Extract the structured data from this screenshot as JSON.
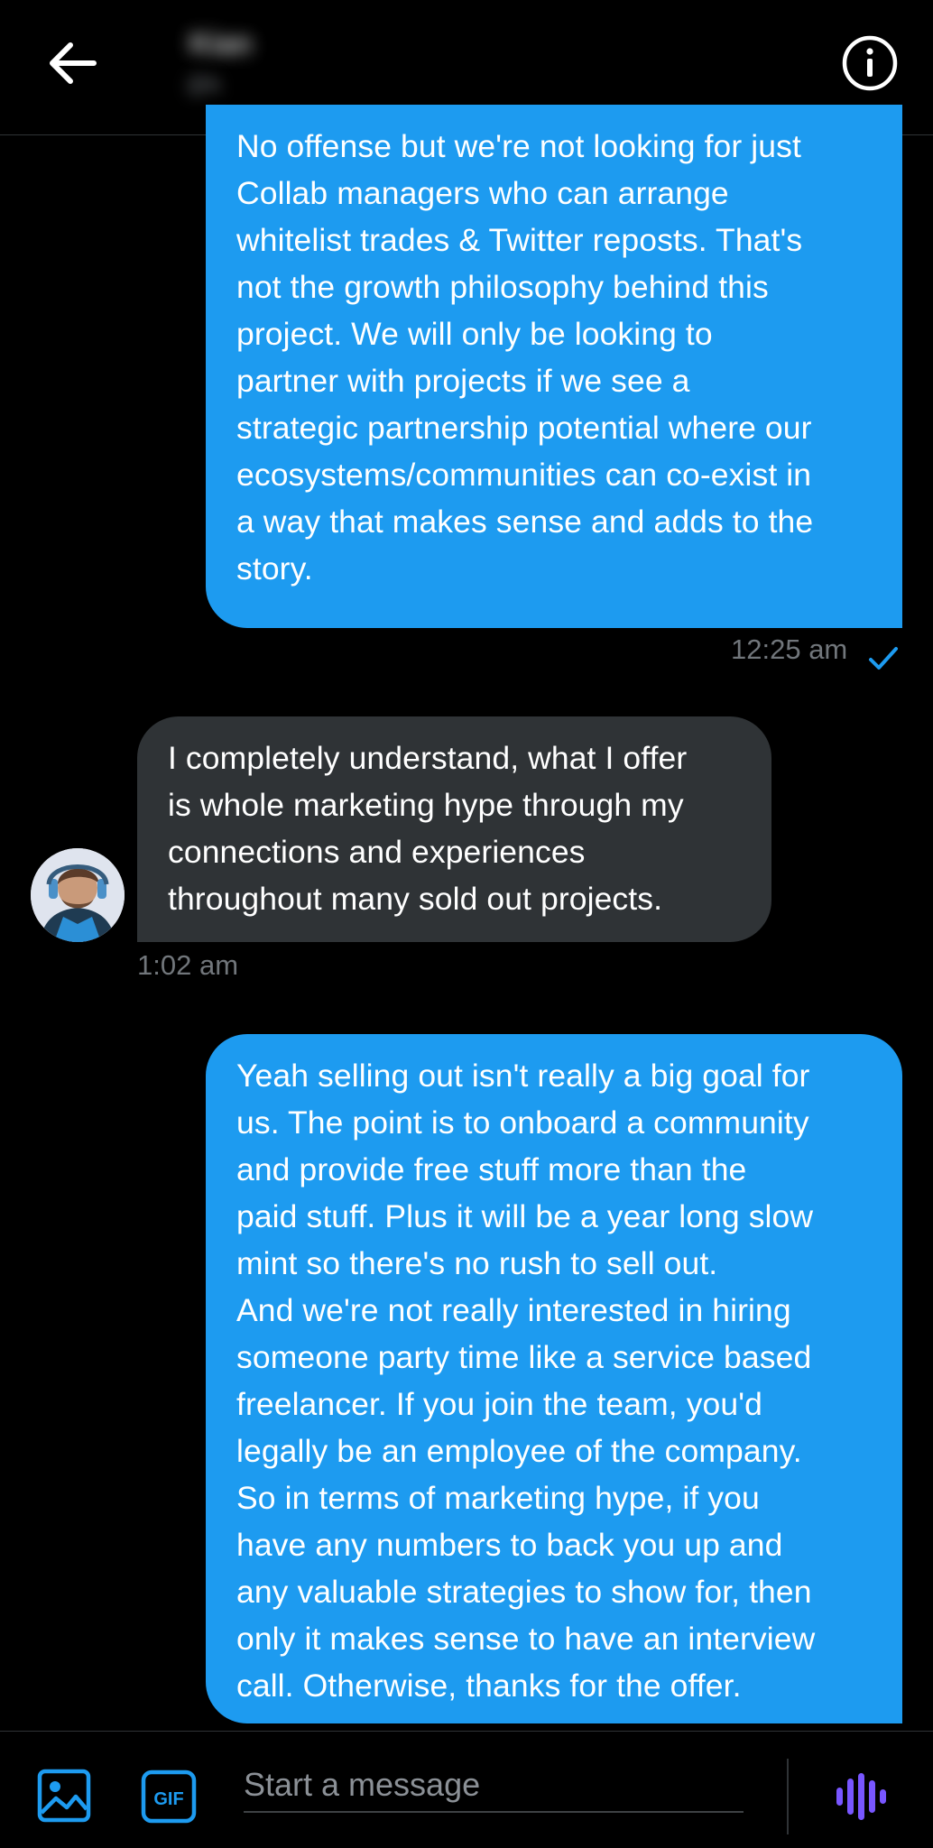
{
  "header": {
    "name": "Kian",
    "handle": "@k"
  },
  "messages": [
    {
      "direction": "out",
      "text": "No offense but we're not looking for just\nCollab managers who can arrange\nwhitelist trades & Twitter reposts. That's\nnot the growth philosophy behind this\nproject. We will only be looking to\npartner with projects if we see a\nstrategic partnership potential where our\necosystems/communities can co-exist in\na way that makes sense and adds to the\nstory.",
      "time": "12:25 am",
      "status_icon": "checkmark-icon"
    },
    {
      "direction": "in",
      "text": "I completely understand, what I offer\nis whole marketing hype through my\nconnections and experiences\nthroughout many sold out projects.",
      "time": "1:02 am"
    },
    {
      "direction": "out",
      "text": "Yeah selling out isn't really a big goal for\nus. The point is to onboard a community\nand provide free stuff more than the\npaid stuff. Plus it will be a year long slow\nmint so there's no rush to sell out.\nAnd we're not really interested in hiring\nsomeone party time like a service based\nfreelancer. If you join the team, you'd\nlegally be an employee of the company.\nSo in terms of marketing hype, if you\nhave any numbers to back you up and\nany valuable strategies to show for, then\nonly it makes sense to have an interview\ncall. Otherwise, thanks for the offer."
    }
  ],
  "composer": {
    "placeholder": "Start a message",
    "gif_label": "GIF"
  },
  "colors": {
    "background": "#000000",
    "outgoing_bubble": "#1d9bf0",
    "incoming_bubble": "#2f3336",
    "accent": "#1d9bf0",
    "timestamp": "#71767b",
    "voice_icon": "#7856ff"
  },
  "icons": {
    "back": "arrow-left-icon",
    "info": "info-icon",
    "image": "image-icon",
    "gif": "gif-icon",
    "voice": "voice-wave-icon"
  }
}
